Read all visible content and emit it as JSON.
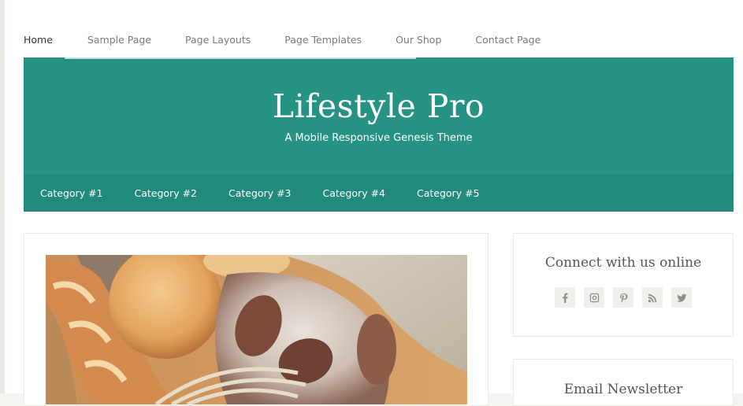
{
  "top_nav": {
    "items": [
      {
        "label": "Home",
        "active": true
      },
      {
        "label": "Sample Page",
        "active": false
      },
      {
        "label": "Page Layouts",
        "active": false
      },
      {
        "label": "Page Templates",
        "active": false
      },
      {
        "label": "Our Shop",
        "active": false
      },
      {
        "label": "Contact Page",
        "active": false
      }
    ]
  },
  "header": {
    "title": "Lifestyle Pro",
    "description": "A Mobile Responsive Genesis Theme",
    "background_color": "#269283"
  },
  "category_nav": {
    "items": [
      {
        "label": "Category #1"
      },
      {
        "label": "Category #2"
      },
      {
        "label": "Category #3"
      },
      {
        "label": "Category #4"
      },
      {
        "label": "Category #5"
      }
    ]
  },
  "main": {
    "featured_image": {
      "alt": "Assorted bread loaves and rolls with wheat on burlap"
    }
  },
  "sidebar": {
    "connect_widget": {
      "title": "Connect with us online",
      "icons": [
        "facebook-icon",
        "instagram-icon",
        "pinterest-icon",
        "rss-icon",
        "twitter-icon"
      ]
    },
    "newsletter_widget": {
      "title": "Email Newsletter"
    }
  }
}
